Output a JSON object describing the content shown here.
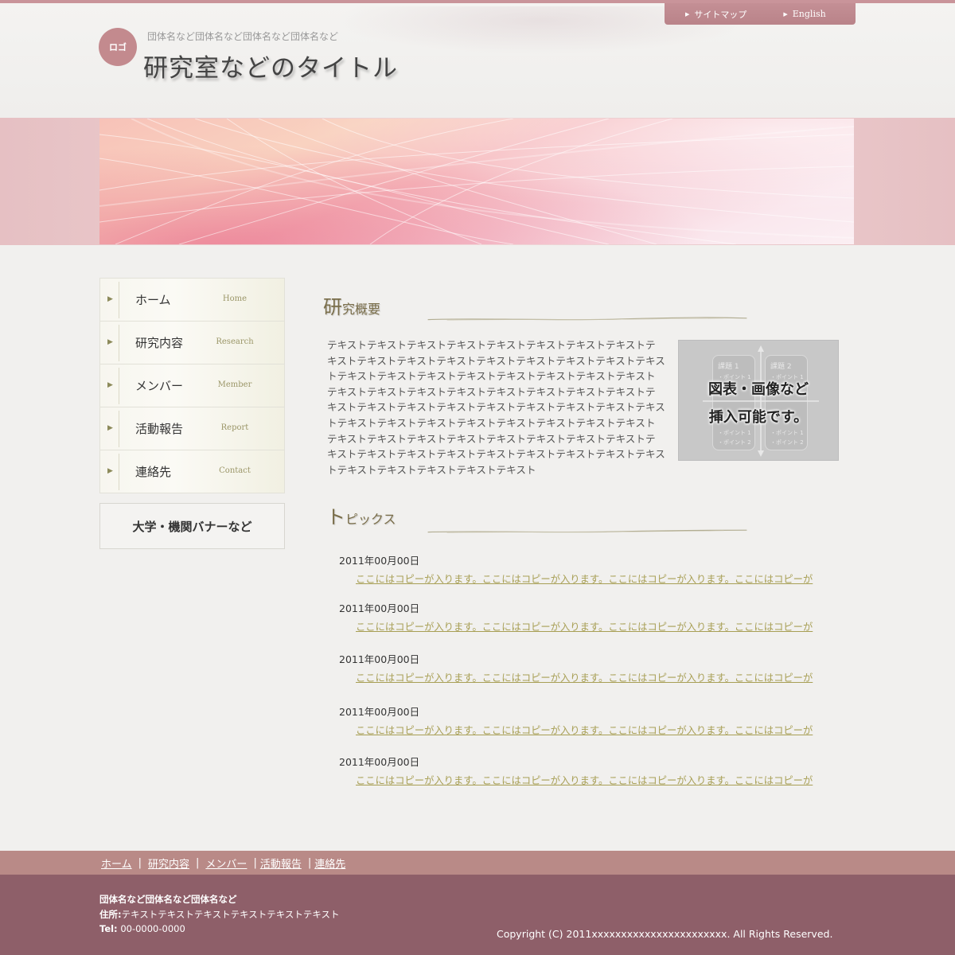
{
  "header": {
    "top_links": [
      {
        "label": "サイトマップ"
      },
      {
        "label": "English"
      }
    ],
    "logo_label": "ロゴ",
    "org_name": "団体名など団体名など団体名など団体名など",
    "site_title": "研究室などのタイトル"
  },
  "sidebar": {
    "nav": [
      {
        "jp": "ホーム",
        "en": "Home"
      },
      {
        "jp": "研究内容",
        "en": "Research"
      },
      {
        "jp": "メンバー",
        "en": "Member"
      },
      {
        "jp": "活動報告",
        "en": "Report"
      },
      {
        "jp": "連絡先",
        "en": "Contact"
      }
    ],
    "banner_label": "大学・機関バナーなど"
  },
  "overview": {
    "heading_first": "研",
    "heading_rest": "究概要",
    "body": "テキストテキストテキストテキストテキストテキストテキストテキストテキストテキストテキストテキストテキストテキストテキストテキストテキストテキストテキストテキストテキストテキストテキストテキストテキストテキストテキストテキストテキストテキストテキストテキストテキストテキストテキストテキストテキストテキストテキストテキストテキストテキストテキストテキストテキストテキストテキストテキストテキストテキストテキストテキストテキストテキストテキストテキストテキストテキストテキストテキストテキストテキストテキストテキストテキストテキストテキストテキストテキストテキストテキストテキスト",
    "figure": {
      "card1_title": "課題 1",
      "card2_title": "課題 2",
      "point1": "・ポイント 1",
      "point2": "・ポイント 2",
      "caption_line1": "図表・画像など",
      "caption_line2": "挿入可能です。"
    }
  },
  "topics": {
    "heading_first": "ト",
    "heading_rest": "ピックス",
    "items": [
      {
        "date": "2011年00月00日",
        "text": "ここにはコピーが入ります。ここにはコピーが入ります。ここにはコピーが入ります。ここにはコピーが"
      },
      {
        "date": "2011年00月00日",
        "text": "ここにはコピーが入ります。ここにはコピーが入ります。ここにはコピーが入ります。ここにはコピーが"
      },
      {
        "date": "2011年00月00日",
        "text": "ここにはコピーが入ります。ここにはコピーが入ります。ここにはコピーが入ります。ここにはコピーが"
      },
      {
        "date": "2011年00月00日",
        "text": "ここにはコピーが入ります。ここにはコピーが入ります。ここにはコピーが入ります。ここにはコピーが"
      },
      {
        "date": "2011年00月00日",
        "text": "ここにはコピーが入ります。ここにはコピーが入ります。ここにはコピーが入ります。ここにはコピーが"
      }
    ]
  },
  "footer": {
    "nav": [
      "ホーム",
      "研究内容",
      "メンバー",
      "活動報告",
      "連絡先"
    ],
    "org": "団体名など団体名など団体名など",
    "address_label": "住所:",
    "address": "テキストテキストテキストテキストテキストテキスト",
    "tel_label": "Tel:",
    "tel": "00-0000-0000",
    "copyright": "Copyright (C) 2011xxxxxxxxxxxxxxxxxxxxxxx. All Rights Reserved."
  },
  "colors": {
    "accent_pink": "#b98389",
    "footer_bg": "#8e5f69",
    "link_olive": "#a89f55"
  }
}
